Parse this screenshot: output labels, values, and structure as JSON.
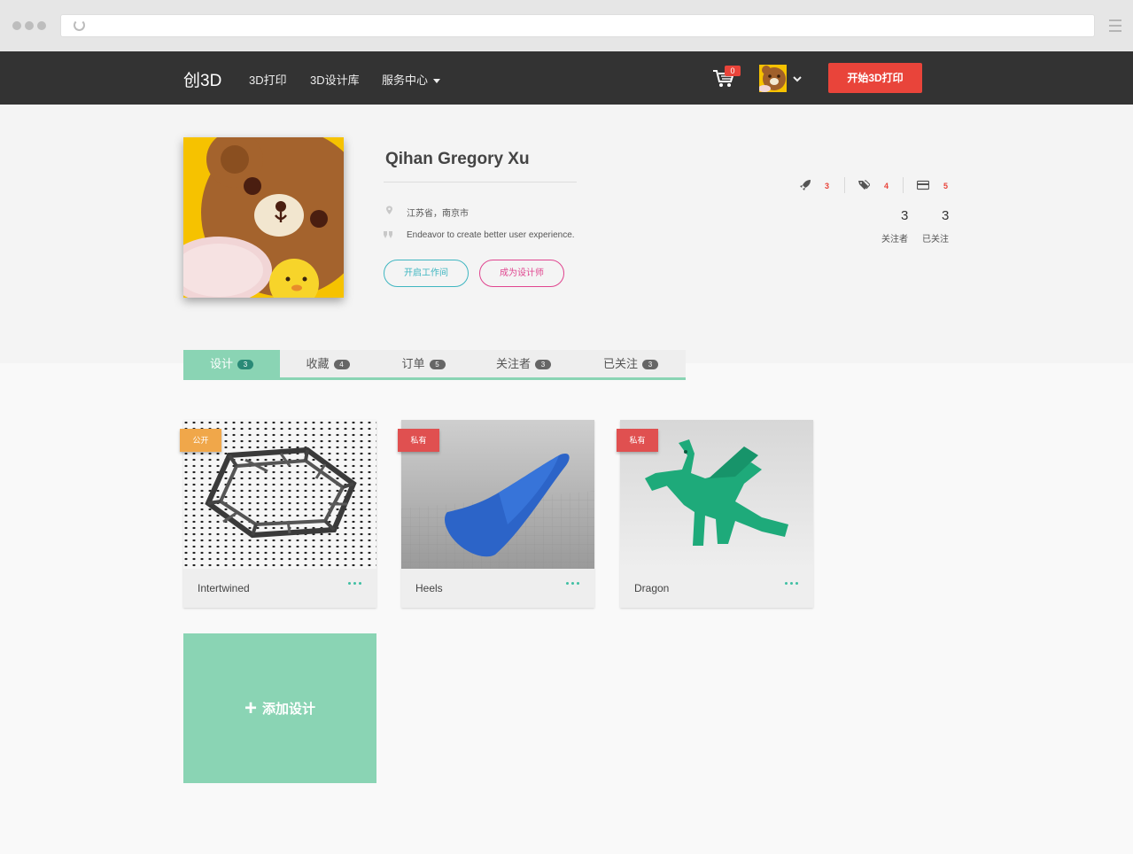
{
  "nav": {
    "logo": "创3D",
    "links": [
      "3D打印",
      "3D设计库",
      "服务中心"
    ],
    "cart_count": "0",
    "start_button": "开始3D打印"
  },
  "profile": {
    "name": "Qihan Gregory Xu",
    "location": "江苏省，南京市",
    "bio": "Endeavor to create better user experience.",
    "btn_workspace": "开启工作间",
    "btn_designer": "成为设计师",
    "stats": [
      {
        "icon": "rocket-icon",
        "value": "3"
      },
      {
        "icon": "tags-icon",
        "value": "4"
      },
      {
        "icon": "card-icon",
        "value": "5"
      }
    ],
    "followers": {
      "value": "3",
      "label": "关注者"
    },
    "following": {
      "value": "3",
      "label": "已关注"
    }
  },
  "tabs": [
    {
      "label": "设计",
      "count": "3"
    },
    {
      "label": "收藏",
      "count": "4"
    },
    {
      "label": "订单",
      "count": "5"
    },
    {
      "label": "关注者",
      "count": "3"
    },
    {
      "label": "已关注",
      "count": "3"
    }
  ],
  "designs": [
    {
      "title": "Intertwined",
      "visibility": "公开"
    },
    {
      "title": "Heels",
      "visibility": "私有"
    },
    {
      "title": "Dragon",
      "visibility": "私有"
    }
  ],
  "add_design": "添加设计",
  "colors": {
    "navbar": "#333333",
    "accent_red": "#e9443a",
    "mint": "#8ad4b4",
    "teal": "#3fb6c1",
    "pink": "#e0458f",
    "ribbon_public": "#f0a74a",
    "ribbon_private": "#e05050"
  }
}
